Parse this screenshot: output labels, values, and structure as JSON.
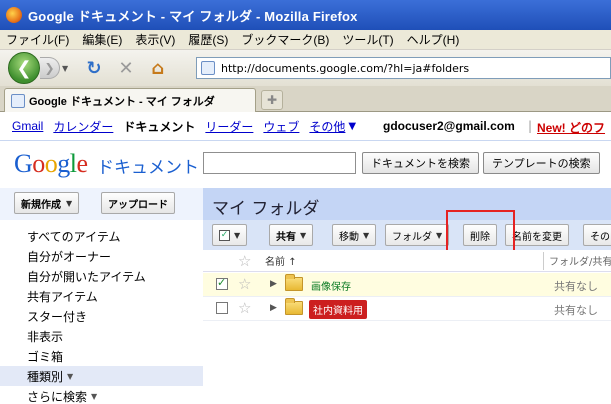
{
  "window": {
    "title": "Google ドキュメント - マイ フォルダ - Mozilla Firefox"
  },
  "menubar": {
    "items": [
      "ファイル(F)",
      "編集(E)",
      "表示(V)",
      "履歴(S)",
      "ブックマーク(B)",
      "ツール(T)",
      "ヘルプ(H)"
    ]
  },
  "navbar": {
    "url": "http://documents.google.com/?hl=ja#folders"
  },
  "tabs": [
    {
      "title": "Google ドキュメント - マイ フォルダ"
    }
  ],
  "google_bar": {
    "links": [
      "Gmail",
      "カレンダー"
    ],
    "current": "ドキュメント",
    "links_after": [
      "リーダー",
      "ウェブ"
    ],
    "more": "その他",
    "user_email": "gdocuser2@gmail.com",
    "separator": "|",
    "new_link": "New! どのフ"
  },
  "header": {
    "logo_letters": [
      "G",
      "o",
      "o",
      "g",
      "l",
      "e"
    ],
    "product_name": "ドキュメント",
    "search_value": "",
    "search_button": "ドキュメントを検索",
    "template_button": "テンプレートの検索"
  },
  "sidebar": {
    "new_button": "新規作成",
    "upload_button": "アップロード",
    "items": [
      {
        "label": "すべてのアイテム"
      },
      {
        "label": "自分がオーナー"
      },
      {
        "label": "自分が開いたアイテム"
      },
      {
        "label": "共有アイテム"
      },
      {
        "label": "スター付き"
      },
      {
        "label": "非表示"
      },
      {
        "label": "ゴミ箱"
      },
      {
        "label": "種類別"
      },
      {
        "label": "さらに検索"
      }
    ]
  },
  "main": {
    "title": "マイ フォルダ",
    "toolbar": {
      "share": "共有",
      "move": "移動",
      "folder": "フォルダ",
      "delete": "削除",
      "rename": "名前を変更",
      "more": "その"
    },
    "columns": {
      "name": "名前",
      "sort_indicator": "↑",
      "folder_share": "フォルダ/共有"
    },
    "rows": [
      {
        "name": "画像保存",
        "share": "共有なし",
        "checked": true,
        "label_style": "green"
      },
      {
        "name": "社内資料用",
        "share": "共有なし",
        "checked": false,
        "label_style": "red"
      }
    ]
  },
  "colors": {
    "title_bar": "#1f4fb8",
    "link": "#0000cc",
    "sidebar_bg": "#eef3fd",
    "main_header_bg": "#c4d5f5",
    "highlight": "#e52222",
    "red_label": "#cc1f1f"
  }
}
